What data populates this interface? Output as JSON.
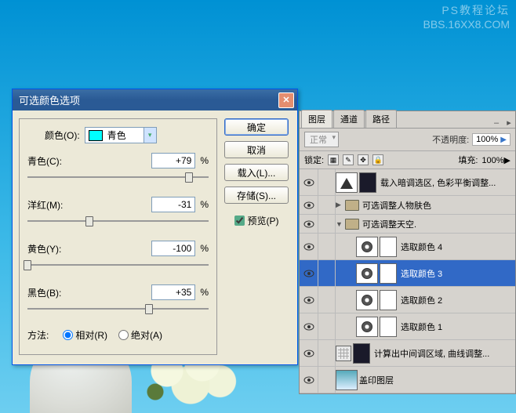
{
  "watermark": {
    "line1": "PS教程论坛",
    "line2": "BBS.16XX8.COM"
  },
  "dialog": {
    "title": "可选颜色选项",
    "color_label": "颜色(O):",
    "color_name": "青色",
    "sliders": [
      {
        "label": "青色(C):",
        "value": "+79",
        "pct": "%",
        "pos": 89
      },
      {
        "label": "洋红(M):",
        "value": "-31",
        "pct": "%",
        "pos": 34
      },
      {
        "label": "黄色(Y):",
        "value": "-100",
        "pct": "%",
        "pos": 0
      },
      {
        "label": "黑色(B):",
        "value": "+35",
        "pct": "%",
        "pos": 67
      }
    ],
    "method_label": "方法:",
    "method_rel": "相对(R)",
    "method_abs": "绝对(A)",
    "buttons": {
      "ok": "确定",
      "cancel": "取消",
      "load": "载入(L)...",
      "save": "存储(S)..."
    },
    "preview": "预览(P)"
  },
  "panel": {
    "tabs": [
      "图层",
      "通道",
      "路径"
    ],
    "blend": "正常",
    "opacity_label": "不透明度:",
    "opacity_val": "100%",
    "lock_label": "锁定:",
    "fill_label": "填充:",
    "fill_val": "100%",
    "layers": [
      {
        "name": "载入暗调选区, 色彩平衡调整...",
        "type": "adj-curve"
      },
      {
        "name": "可选调整人物肤色",
        "type": "group",
        "open": false
      },
      {
        "name": "可选调整天空.",
        "type": "group",
        "open": true
      },
      {
        "name": "选取颜色 4",
        "type": "adj-sel",
        "sub": true
      },
      {
        "name": "选取颜色 3",
        "type": "adj-sel",
        "sub": true,
        "selected": true
      },
      {
        "name": "选取颜色 2",
        "type": "adj-sel",
        "sub": true
      },
      {
        "name": "选取颜色 1",
        "type": "adj-sel",
        "sub": true
      },
      {
        "name": "计算出中间调区域, 曲线调整...",
        "type": "adj-curve2"
      },
      {
        "name": "盖印图层",
        "type": "img"
      }
    ]
  }
}
